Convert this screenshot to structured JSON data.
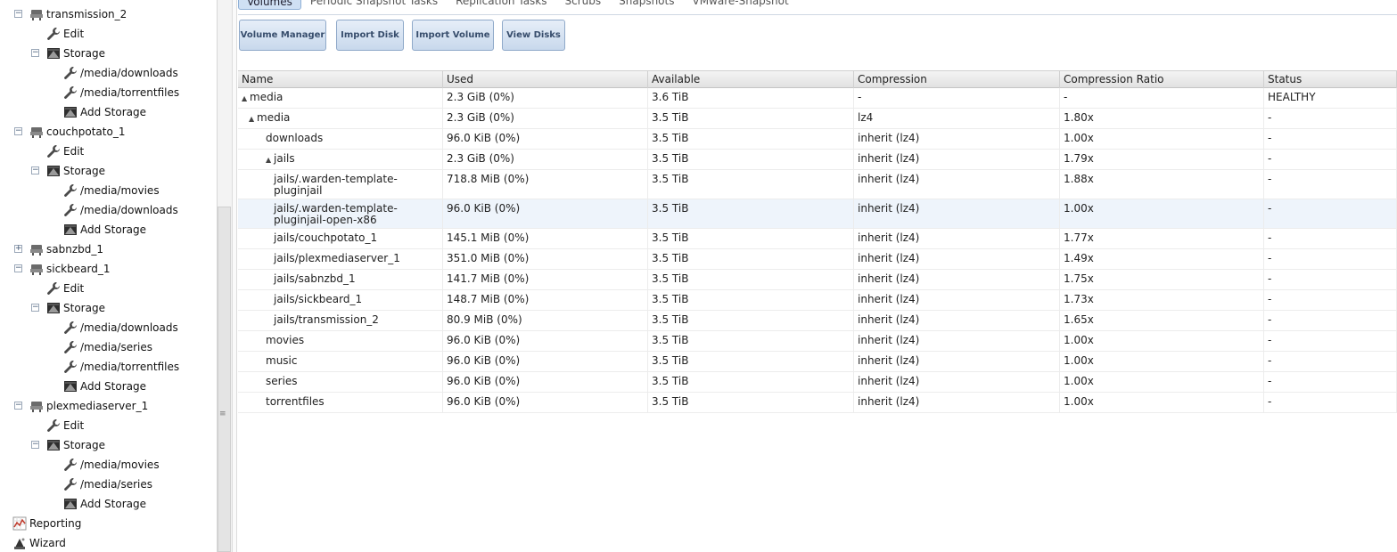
{
  "sidebar": {
    "tree": [
      {
        "label": "transmission_2",
        "indent": 0,
        "icon": "jail-icon",
        "expander": "minus"
      },
      {
        "label": "Edit",
        "indent": 1,
        "icon": "wrench-icon"
      },
      {
        "label": "Storage",
        "indent": 1,
        "icon": "storage-icon",
        "expander": "minus"
      },
      {
        "label": "/media/downloads",
        "indent": 2,
        "icon": "wrench-icon"
      },
      {
        "label": "/media/torrentfiles",
        "indent": 2,
        "icon": "wrench-icon"
      },
      {
        "label": "Add Storage",
        "indent": 2,
        "icon": "storage-icon"
      },
      {
        "label": "couchpotato_1",
        "indent": 0,
        "icon": "jail-icon",
        "expander": "minus"
      },
      {
        "label": "Edit",
        "indent": 1,
        "icon": "wrench-icon"
      },
      {
        "label": "Storage",
        "indent": 1,
        "icon": "storage-icon",
        "expander": "minus"
      },
      {
        "label": "/media/movies",
        "indent": 2,
        "icon": "wrench-icon"
      },
      {
        "label": "/media/downloads",
        "indent": 2,
        "icon": "wrench-icon"
      },
      {
        "label": "Add Storage",
        "indent": 2,
        "icon": "storage-icon"
      },
      {
        "label": "sabnzbd_1",
        "indent": 0,
        "icon": "jail-icon",
        "expander": "plus"
      },
      {
        "label": "sickbeard_1",
        "indent": 0,
        "icon": "jail-icon",
        "expander": "minus"
      },
      {
        "label": "Edit",
        "indent": 1,
        "icon": "wrench-icon"
      },
      {
        "label": "Storage",
        "indent": 1,
        "icon": "storage-icon",
        "expander": "minus"
      },
      {
        "label": "/media/downloads",
        "indent": 2,
        "icon": "wrench-icon"
      },
      {
        "label": "/media/series",
        "indent": 2,
        "icon": "wrench-icon"
      },
      {
        "label": "/media/torrentfiles",
        "indent": 2,
        "icon": "wrench-icon"
      },
      {
        "label": "Add Storage",
        "indent": 2,
        "icon": "storage-icon"
      },
      {
        "label": "plexmediaserver_1",
        "indent": 0,
        "icon": "jail-icon",
        "expander": "minus"
      },
      {
        "label": "Edit",
        "indent": 1,
        "icon": "wrench-icon"
      },
      {
        "label": "Storage",
        "indent": 1,
        "icon": "storage-icon",
        "expander": "minus"
      },
      {
        "label": "/media/movies",
        "indent": 2,
        "icon": "wrench-icon"
      },
      {
        "label": "/media/series",
        "indent": 2,
        "icon": "wrench-icon"
      },
      {
        "label": "Add Storage",
        "indent": 2,
        "icon": "storage-icon"
      },
      {
        "label": "Reporting",
        "indent": -1,
        "icon": "chart-icon"
      },
      {
        "label": "Wizard",
        "indent": -1,
        "icon": "wizard-icon"
      }
    ]
  },
  "tabs": [
    "Volumes",
    "Periodic Snapshot Tasks",
    "Replication Tasks",
    "Scrubs",
    "Snapshots",
    "VMware-Snapshot"
  ],
  "active_tab": 0,
  "toolbar": [
    "Volume Manager",
    "Import Disk",
    "Import Volume",
    "View Disks"
  ],
  "grid": {
    "columns": [
      "Name",
      "Used",
      "Available",
      "Compression",
      "Compression Ratio",
      "Status"
    ],
    "rows": [
      {
        "name": "media",
        "level": 0,
        "twist": "▲",
        "used": "2.3 GiB (0%)",
        "available": "3.6 TiB",
        "compression": "-",
        "ratio": "-",
        "status": "HEALTHY"
      },
      {
        "name": "media",
        "level": 1,
        "twist": "▲",
        "used": "2.3 GiB (0%)",
        "available": "3.5 TiB",
        "compression": "lz4",
        "ratio": "1.80x",
        "status": "-"
      },
      {
        "name": "downloads",
        "level": 2,
        "twist": "",
        "used": "96.0 KiB (0%)",
        "available": "3.5 TiB",
        "compression": "inherit (lz4)",
        "ratio": "1.00x",
        "status": "-"
      },
      {
        "name": "jails",
        "level": 2,
        "twist": "▲",
        "used": "2.3 GiB (0%)",
        "available": "3.5 TiB",
        "compression": "inherit (lz4)",
        "ratio": "1.79x",
        "status": "-"
      },
      {
        "name": "jails/.warden-template-\npluginjail",
        "level": 3,
        "twist": "",
        "used": "718.8 MiB (0%)",
        "available": "3.5 TiB",
        "compression": "inherit (lz4)",
        "ratio": "1.88x",
        "status": "-"
      },
      {
        "name": "jails/.warden-template-\npluginjail-open-x86",
        "level": 3,
        "twist": "",
        "used": "96.0 KiB (0%)",
        "available": "3.5 TiB",
        "compression": "inherit (lz4)",
        "ratio": "1.00x",
        "status": "-"
      },
      {
        "name": "jails/couchpotato_1",
        "level": 3,
        "twist": "",
        "used": "145.1 MiB (0%)",
        "available": "3.5 TiB",
        "compression": "inherit (lz4)",
        "ratio": "1.77x",
        "status": "-"
      },
      {
        "name": "jails/plexmediaserver_1",
        "level": 3,
        "twist": "",
        "used": "351.0 MiB (0%)",
        "available": "3.5 TiB",
        "compression": "inherit (lz4)",
        "ratio": "1.49x",
        "status": "-"
      },
      {
        "name": "jails/sabnzbd_1",
        "level": 3,
        "twist": "",
        "used": "141.7 MiB (0%)",
        "available": "3.5 TiB",
        "compression": "inherit (lz4)",
        "ratio": "1.75x",
        "status": "-"
      },
      {
        "name": "jails/sickbeard_1",
        "level": 3,
        "twist": "",
        "used": "148.7 MiB (0%)",
        "available": "3.5 TiB",
        "compression": "inherit (lz4)",
        "ratio": "1.73x",
        "status": "-"
      },
      {
        "name": "jails/transmission_2",
        "level": 3,
        "twist": "",
        "used": "80.9 MiB (0%)",
        "available": "3.5 TiB",
        "compression": "inherit (lz4)",
        "ratio": "1.65x",
        "status": "-"
      },
      {
        "name": "movies",
        "level": 2,
        "twist": "",
        "used": "96.0 KiB (0%)",
        "available": "3.5 TiB",
        "compression": "inherit (lz4)",
        "ratio": "1.00x",
        "status": "-"
      },
      {
        "name": "music",
        "level": 2,
        "twist": "",
        "used": "96.0 KiB (0%)",
        "available": "3.5 TiB",
        "compression": "inherit (lz4)",
        "ratio": "1.00x",
        "status": "-"
      },
      {
        "name": "series",
        "level": 2,
        "twist": "",
        "used": "96.0 KiB (0%)",
        "available": "3.5 TiB",
        "compression": "inherit (lz4)",
        "ratio": "1.00x",
        "status": "-"
      },
      {
        "name": "torrentfiles",
        "level": 2,
        "twist": "",
        "used": "96.0 KiB (0%)",
        "available": "3.5 TiB",
        "compression": "inherit (lz4)",
        "ratio": "1.00x",
        "status": "-"
      }
    ],
    "selected_row": 5
  }
}
